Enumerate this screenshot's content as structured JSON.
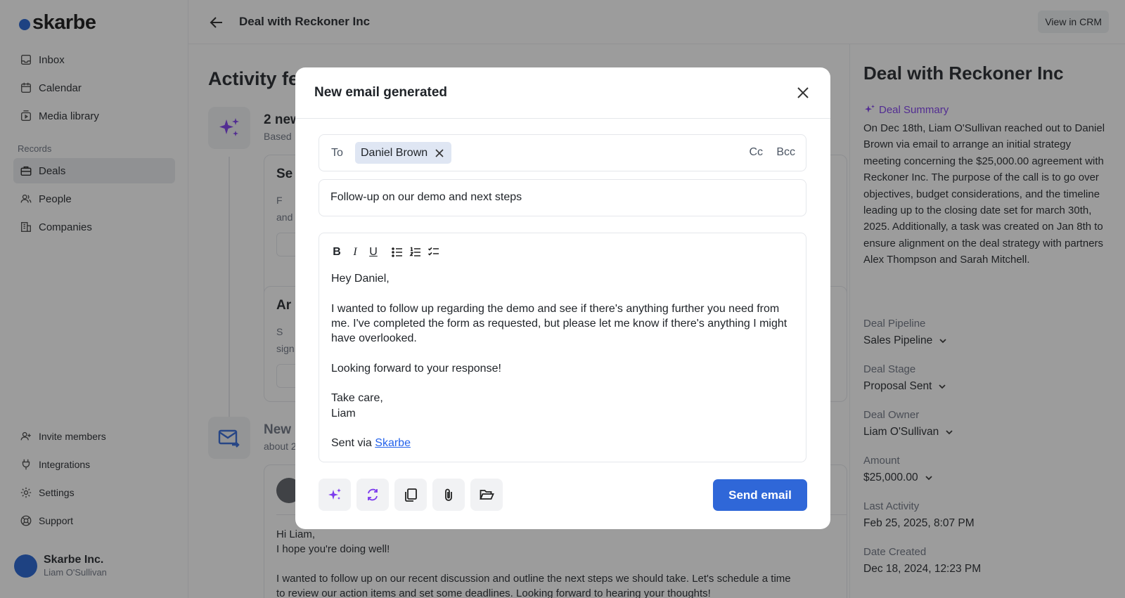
{
  "app": {
    "logo_text": "skarbe"
  },
  "sidebar": {
    "nav": [
      {
        "label": "Inbox"
      },
      {
        "label": "Calendar"
      },
      {
        "label": "Media library"
      }
    ],
    "records_label": "Records",
    "records": [
      {
        "label": "Deals",
        "active": true
      },
      {
        "label": "People"
      },
      {
        "label": "Companies"
      }
    ],
    "bottom": [
      {
        "label": "Invite members"
      },
      {
        "label": "Integrations"
      },
      {
        "label": "Settings"
      },
      {
        "label": "Support"
      }
    ],
    "user": {
      "org": "Skarbe Inc.",
      "name": "Liam O'Sullivan"
    }
  },
  "header": {
    "title": "Deal with Reckoner Inc",
    "view_crm": "View in CRM"
  },
  "feed": {
    "title": "Activity fe",
    "item1": {
      "heading": "2 new",
      "sub": "Based"
    },
    "card1": {
      "title": "Se",
      "line1": "F",
      "line2": "and"
    },
    "card2": {
      "title": "Ar",
      "line1": "S",
      "line2": "sign"
    },
    "item2": {
      "heading": "New",
      "sub": "about 2"
    },
    "mail": {
      "lines": [
        "Hi Liam,",
        "I hope you're doing well!",
        "I wanted to follow up on our recent discussion and outline the next steps we should take. Let's schedule a time",
        "to review our action items and set some deadlines. Looking forward to hearing your thoughts!"
      ]
    }
  },
  "panel": {
    "title": "Deal with Reckoner Inc",
    "summary_label": "Deal Summary",
    "summary": "On Dec 18th, Liam O'Sullivan reached out to Daniel Brown via email to arrange an initial strategy meeting concerning the $25,000.00 agreement with Reckoner Inc. The purpose of the call is to go over objectives, budget considerations, and the timeline leading up to the closing date set for march 30th, 2025. Additionally, a task was created on Jan 8th to ensure alignment on the deal strategy with partners Alex Thompson and Sarah Mitchell.",
    "fields": [
      {
        "label": "Deal Pipeline",
        "value": "Sales Pipeline",
        "dropdown": true
      },
      {
        "label": "Deal Stage",
        "value": "Proposal Sent",
        "dropdown": true
      },
      {
        "label": "Deal Owner",
        "value": "Liam O'Sullivan",
        "dropdown": true
      },
      {
        "label": "Amount",
        "value": "$25,000.00",
        "dropdown": true
      },
      {
        "label": "Last Activity",
        "value": "Feb 25, 2025, 8:07 PM",
        "dropdown": false
      },
      {
        "label": "Date Created",
        "value": "Dec 18, 2024, 12:23 PM",
        "dropdown": false
      }
    ]
  },
  "modal": {
    "title": "New email generated",
    "to_label": "To",
    "recipient": "Daniel Brown",
    "cc": "Cc",
    "bcc": "Bcc",
    "subject": "Follow-up on our demo and next steps",
    "toolbar": {
      "bold": "B",
      "italic": "I",
      "underline": "U"
    },
    "body": {
      "greeting": "Hey Daniel,",
      "para1": "I wanted to follow up regarding the demo and see if there's anything further you need from me. I've completed the form as requested, but please let me know if there's anything I might have overlooked.",
      "para2": "Looking forward to your response!",
      "closing": "Take care,",
      "signature": "Liam",
      "sent_via_prefix": "Sent via ",
      "sent_via_link": "Skarbe"
    },
    "send_label": "Send email"
  },
  "icons": {
    "sparkle": "sparkle-icon",
    "regenerate": "regenerate-icon",
    "copy": "copy-icon",
    "attach": "paperclip-icon",
    "folder": "folder-open-icon"
  },
  "colors": {
    "accent": "#2f67d8",
    "ai_purple": "#7c3aed",
    "logo_blue": "#1f5fd0"
  }
}
